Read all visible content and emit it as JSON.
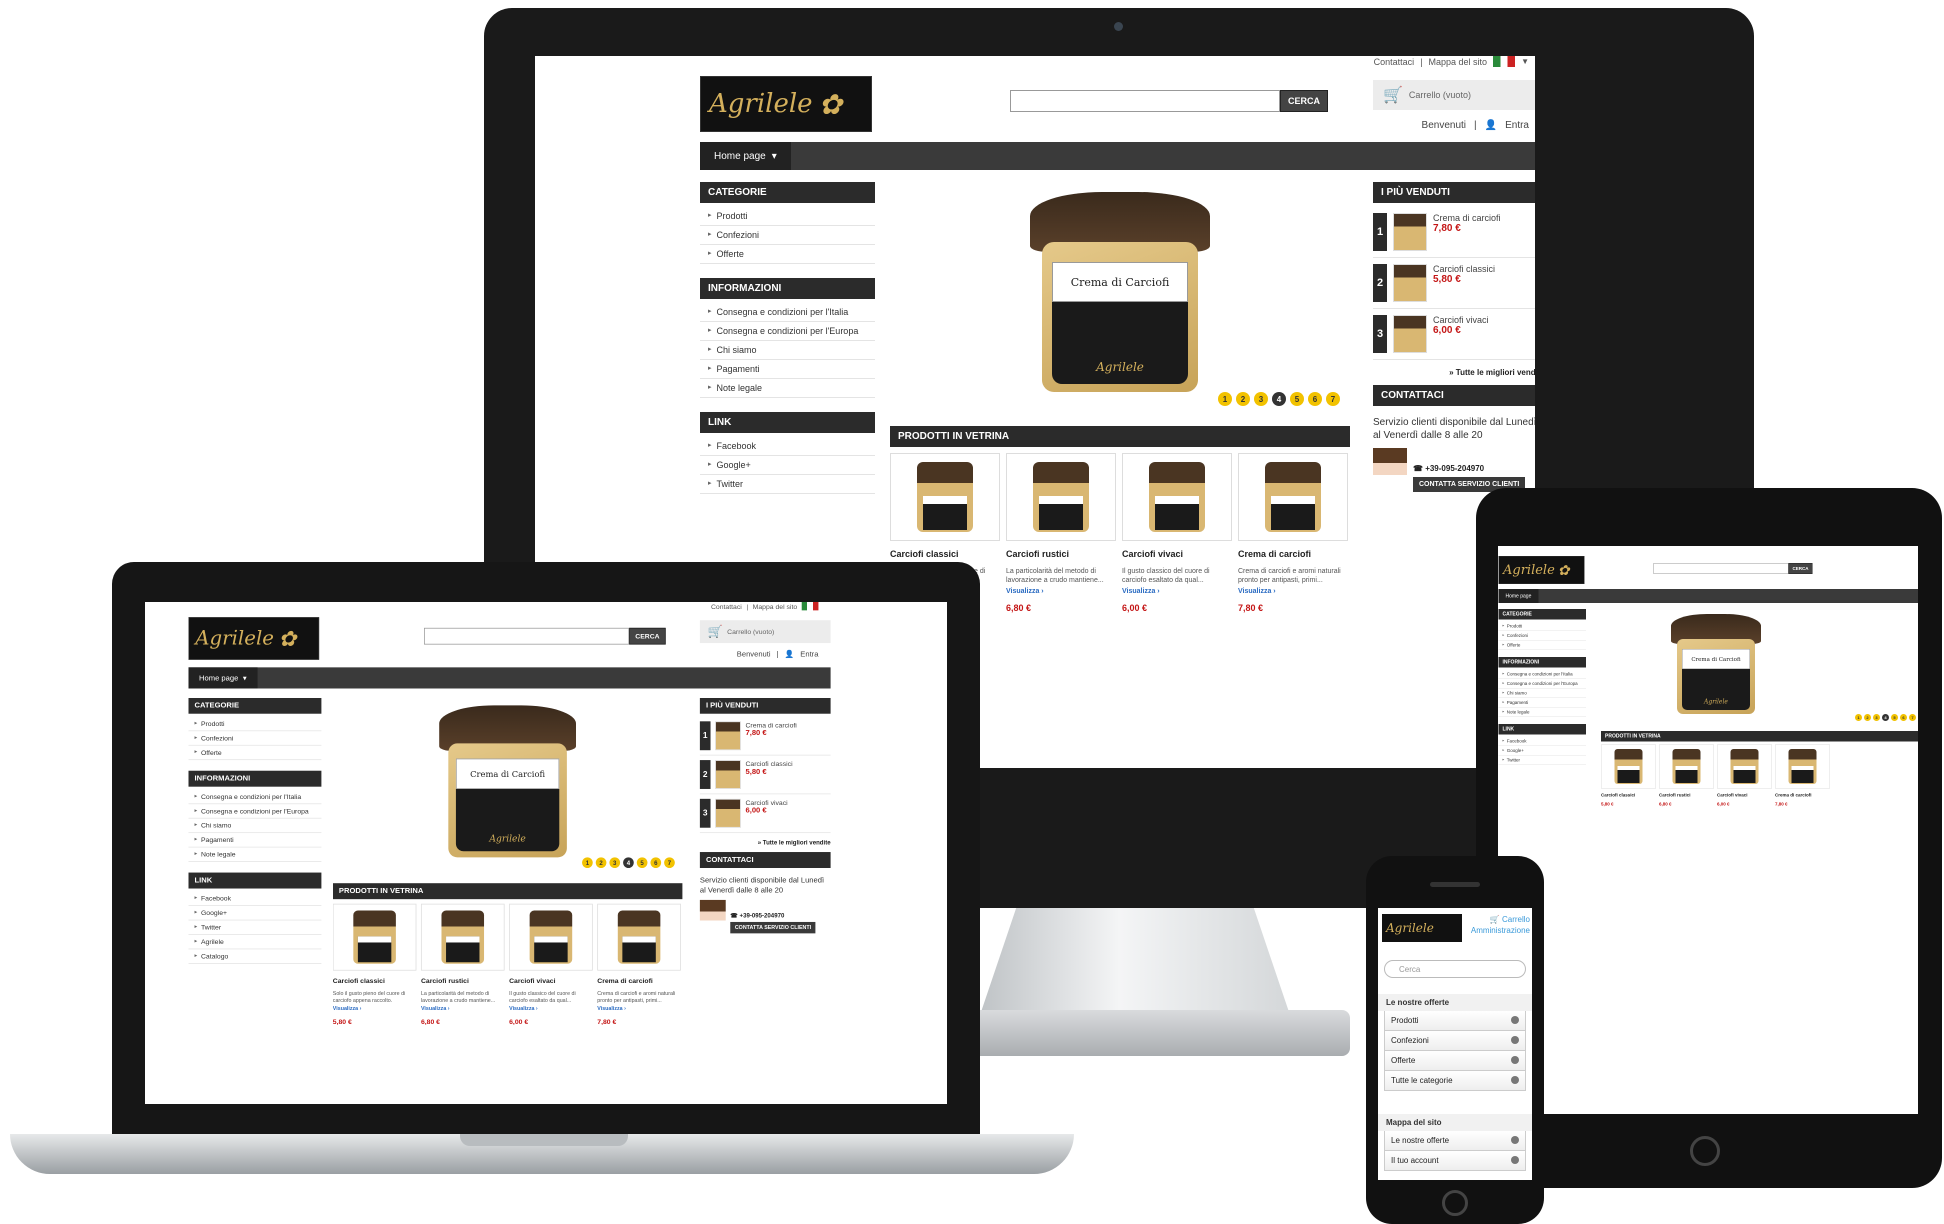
{
  "site": {
    "top_links": [
      "Contattaci",
      "Mappa del sito"
    ],
    "logo": "Agrilele",
    "search_button": "CERCA",
    "cart_label": "Carrello (vuoto)",
    "welcome": "Benvenuti",
    "login": "Entra",
    "nav_home": "Home page",
    "categories": {
      "title": "CATEGORIE",
      "items": [
        "Prodotti",
        "Confezioni",
        "Offerte"
      ]
    },
    "info": {
      "title": "INFORMAZIONI",
      "items": [
        "Consegna e condizioni per l'Italia",
        "Consegna e condizioni per l'Europa",
        "Chi siamo",
        "Pagamenti",
        "Note legale"
      ]
    },
    "links": {
      "title": "LINK",
      "items": [
        "Facebook",
        "Google+",
        "Twitter",
        "Agrilele",
        "Catalogo"
      ]
    },
    "slider": {
      "jar_label": "Crema di Carciofi",
      "jar_brand": "Agrilele",
      "dots": [
        "1",
        "2",
        "3",
        "4",
        "5",
        "6",
        "7"
      ],
      "active_dot": "4"
    },
    "vetrina": {
      "title": "PRODOTTI IN VETRINA",
      "items": [
        {
          "name": "Carciofi classici",
          "desc": "Solo il gusto pieno del cuore di carciofo appena raccolto.",
          "more": "Visualizza ›",
          "price": "5,80 €"
        },
        {
          "name": "Carciofi rustici",
          "desc": "La particolarità del metodo di lavorazione a crudo mantiene...",
          "more": "Visualizza ›",
          "price": "6,80 €"
        },
        {
          "name": "Carciofi vivaci",
          "desc": "Il gusto classico del cuore di carciofo esaltato da qual...",
          "more": "Visualizza ›",
          "price": "6,00 €"
        },
        {
          "name": "Crema di carciofi",
          "desc": "Crema di carciofi e aromi naturali pronto per antipasti, primi...",
          "more": "Visualizza ›",
          "price": "7,80 €"
        }
      ]
    },
    "bestsellers": {
      "title": "I PIÙ VENDUTI",
      "items": [
        {
          "rank": "1",
          "name": "Crema di carciofi",
          "price": "7,80 €"
        },
        {
          "rank": "2",
          "name": "Carciofi classici",
          "price": "5,80 €"
        },
        {
          "rank": "3",
          "name": "Carciofi vivaci",
          "price": "6,00 €"
        }
      ],
      "all_link": "» Tutte le migliori vendite"
    },
    "contact": {
      "title": "CONTATTACI",
      "text": "Servizio clienti disponibile dal Lunedì al Venerdì dalle 8 alle 20",
      "phone": "+39-095-204970",
      "button": "CONTATTA SERVIZIO CLIENTI"
    }
  },
  "mobile": {
    "cart": "Carrello",
    "account": "Amministrazione",
    "search_placeholder": "Cerca",
    "offers_title": "Le nostre offerte",
    "offers": [
      "Prodotti",
      "Confezioni",
      "Offerte",
      "Tutte le categorie"
    ],
    "sitemap_title": "Mappa del sito",
    "sitemap": [
      "Le nostre offerte",
      "Il tuo account"
    ]
  },
  "colors": {
    "dark_bar": "#2b2b2b",
    "price": "#c41616",
    "dot": "#f2c200",
    "link": "#2a6bc2"
  }
}
